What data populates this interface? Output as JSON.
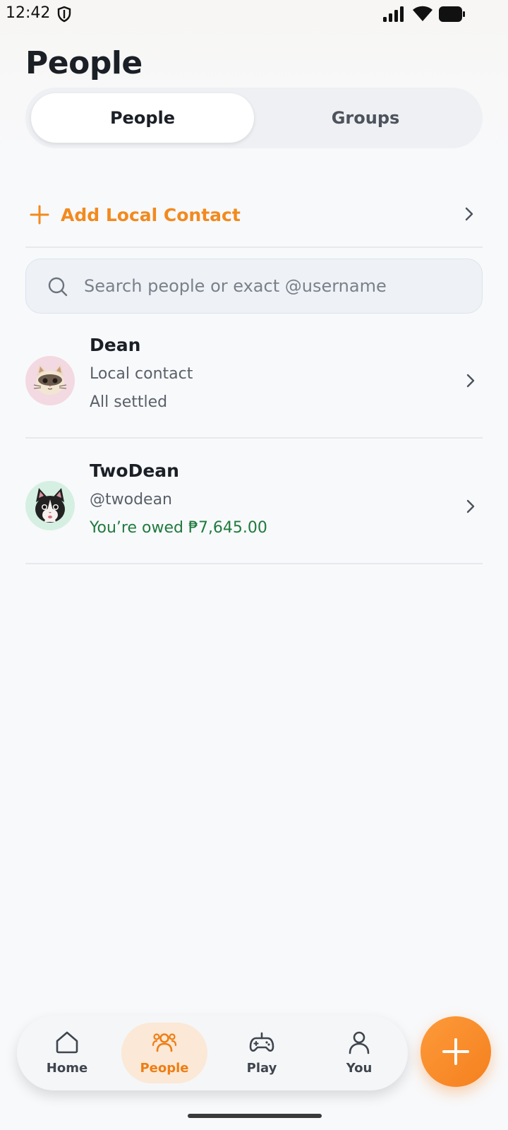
{
  "status_bar": {
    "time": "12:42"
  },
  "header": {
    "title": "People"
  },
  "segmented": {
    "people_label": "People",
    "groups_label": "Groups"
  },
  "add_contact": {
    "label": "Add Local Contact"
  },
  "search": {
    "placeholder": "Search people or exact @username",
    "value": ""
  },
  "people": [
    {
      "name": "Dean",
      "subtitle": "Local contact",
      "status": "All settled",
      "status_type": "neutral",
      "avatar": "cat-cream-avatar"
    },
    {
      "name": "TwoDean",
      "subtitle": "@twodean",
      "status": "You’re owed ₱7,645.00",
      "status_type": "positive",
      "avatar": "cat-black-avatar"
    }
  ],
  "bottom_nav": {
    "items": [
      {
        "label": "Home",
        "icon": "home-icon",
        "active": false
      },
      {
        "label": "People",
        "icon": "people-icon",
        "active": true
      },
      {
        "label": "Play",
        "icon": "gamepad-icon",
        "active": false
      },
      {
        "label": "You",
        "icon": "user-icon",
        "active": false
      }
    ]
  },
  "colors": {
    "accent": "#f28a1e",
    "positive": "#1f7a3e",
    "active_nav_bg": "#fbe8d6"
  }
}
